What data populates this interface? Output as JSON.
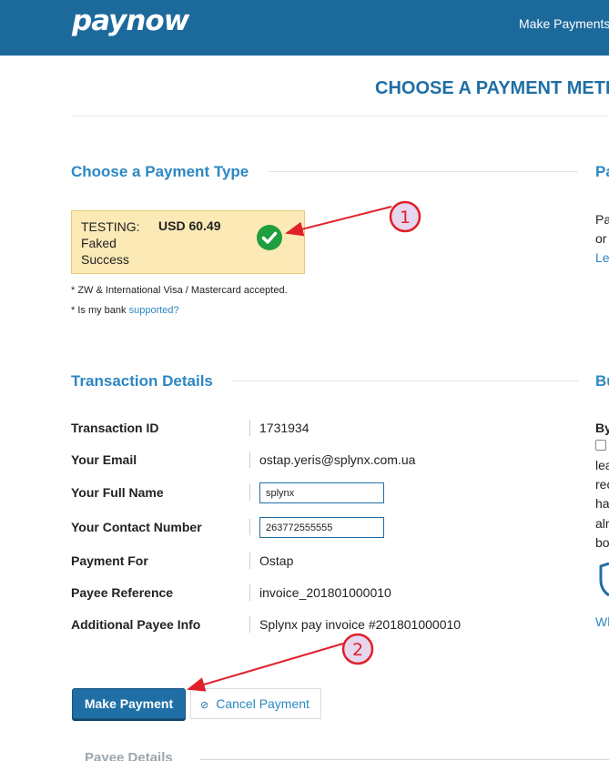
{
  "header": {
    "logo": "paynow",
    "nav_item": "Make Payments"
  },
  "page_title": "CHOOSE A PAYMENT METH",
  "payment_type": {
    "section_title": "Choose a Payment Type",
    "card_type": "TESTING: Faked Success",
    "card_amount": "USD 60.49",
    "note_cards": "* ZW & International Visa / Mastercard accepted.",
    "note_bank_prefix": "* Is my bank",
    "note_bank_link": "supported?"
  },
  "transaction": {
    "section_title": "Transaction Details",
    "rows": [
      {
        "label": "Transaction ID",
        "value": "1731934"
      },
      {
        "label": "Your Email",
        "value": "ostap.yeris@splynx.com.ua"
      },
      {
        "label": "Your Full Name",
        "value": "splynx"
      },
      {
        "label": "Your Contact Number",
        "value": "263772555555"
      },
      {
        "label": "Payment For",
        "value": "Ostap"
      },
      {
        "label": "Payee Reference",
        "value": "invoice_201801000010"
      },
      {
        "label": "Additional Payee Info",
        "value": "Splynx pay invoice #201801000010"
      }
    ]
  },
  "buttons": {
    "make_payment": "Make Payment",
    "cancel_payment": "Cancel Payment"
  },
  "payee_details_title": "Payee Details",
  "right_column": {
    "title_1": "Pa",
    "text_1a": "Pa",
    "text_1b": "or",
    "link_1": "Le",
    "title_2": "Bu",
    "bold_2": "By",
    "lines": [
      "lea",
      "rec",
      "ha",
      "alr",
      "bo"
    ],
    "link_2": "Wh"
  },
  "annotations": [
    "1",
    "2"
  ],
  "colors": {
    "header_bg": "#1c6a9c",
    "accent": "#2d87c2",
    "card_bg": "#fbe9b6",
    "success": "#1e9e3e",
    "annotation_red": "#e0202a",
    "annotation_fill": "#e6d7ee"
  }
}
